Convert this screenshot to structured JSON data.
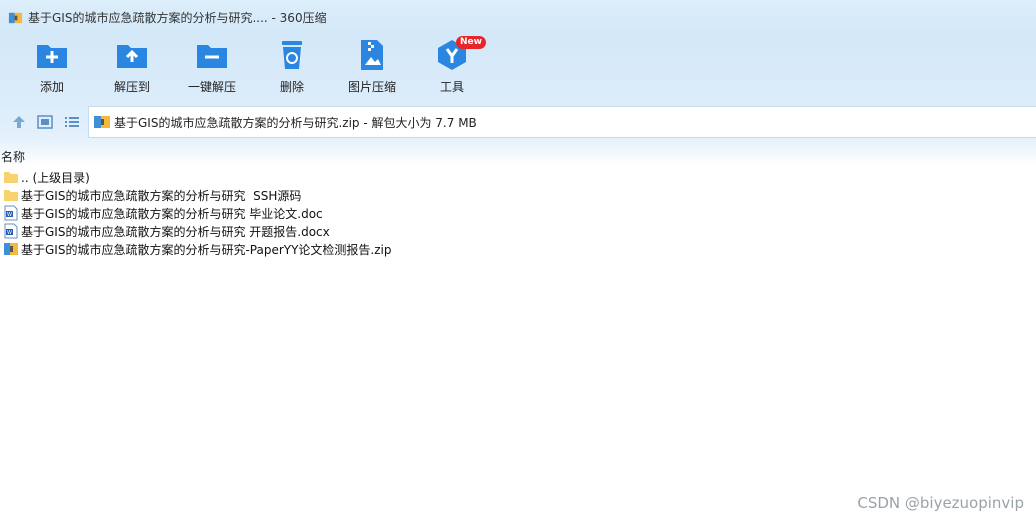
{
  "window": {
    "title": "基于GIS的城市应急疏散方案的分析与研究.... - 360压缩"
  },
  "toolbar": {
    "items": [
      {
        "label": "添加",
        "icon": "add-folder-icon"
      },
      {
        "label": "解压到",
        "icon": "extract-to-folder-icon"
      },
      {
        "label": "一键解压",
        "icon": "one-click-extract-icon"
      },
      {
        "label": "删除",
        "icon": "recycle-bin-icon"
      },
      {
        "label": "图片压缩",
        "icon": "image-compress-icon"
      },
      {
        "label": "工具",
        "icon": "tools-icon",
        "badge": "New"
      }
    ]
  },
  "address": {
    "text": "基于GIS的城市应急疏散方案的分析与研究.zip - 解包大小为 7.7 MB"
  },
  "list": {
    "header": "名称",
    "rows": [
      {
        "name": ".. (上级目录)",
        "type": "folder"
      },
      {
        "name": "基于GIS的城市应急疏散方案的分析与研究  SSH源码",
        "type": "folder"
      },
      {
        "name": "基于GIS的城市应急疏散方案的分析与研究 毕业论文.doc",
        "type": "doc"
      },
      {
        "name": "基于GIS的城市应急疏散方案的分析与研究 开题报告.docx",
        "type": "docx"
      },
      {
        "name": "基于GIS的城市应急疏散方案的分析与研究-PaperYY论文检测报告.zip",
        "type": "zip"
      }
    ]
  },
  "watermark": "CSDN @biyezuopinvip",
  "colors": {
    "accent": "#2a86e0",
    "badge": "#e8262a",
    "folder": "#f7d26e"
  }
}
